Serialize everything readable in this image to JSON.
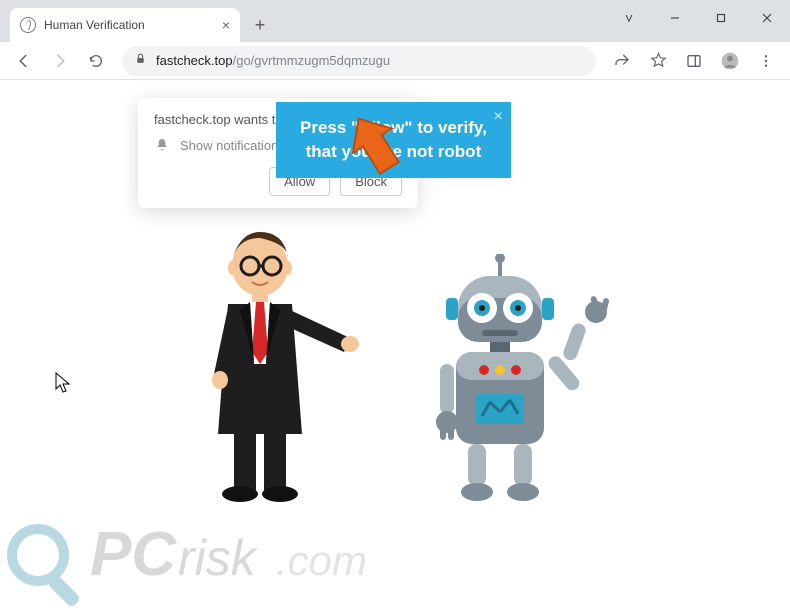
{
  "window": {
    "chev": "˅"
  },
  "tab": {
    "title": "Human Verification"
  },
  "nav": {
    "url_domain": "fastcheck.top",
    "url_path": "/go/gvrtmmzugm5dqmzugu"
  },
  "notif": {
    "title_prefix": "fastcheck.top",
    "title_suffix": " wants to",
    "row": "Show notifications",
    "allow": "Allow",
    "block": "Block"
  },
  "banner": {
    "line1": "Press \"Allow\" to verify,",
    "line2": "that you are not robot",
    "close": "×"
  },
  "watermark": {
    "text": "PCrisk.com"
  },
  "colors": {
    "banner_bg": "#29abe2",
    "arrow": "#e8651a",
    "robot_body": "#7d8c96",
    "robot_light": "#aab6bd",
    "robot_accent": "#2aa3c4",
    "suit": "#1e1e1e",
    "tie": "#d62828",
    "skin": "#f6c79a",
    "hair": "#4a2f1a"
  }
}
